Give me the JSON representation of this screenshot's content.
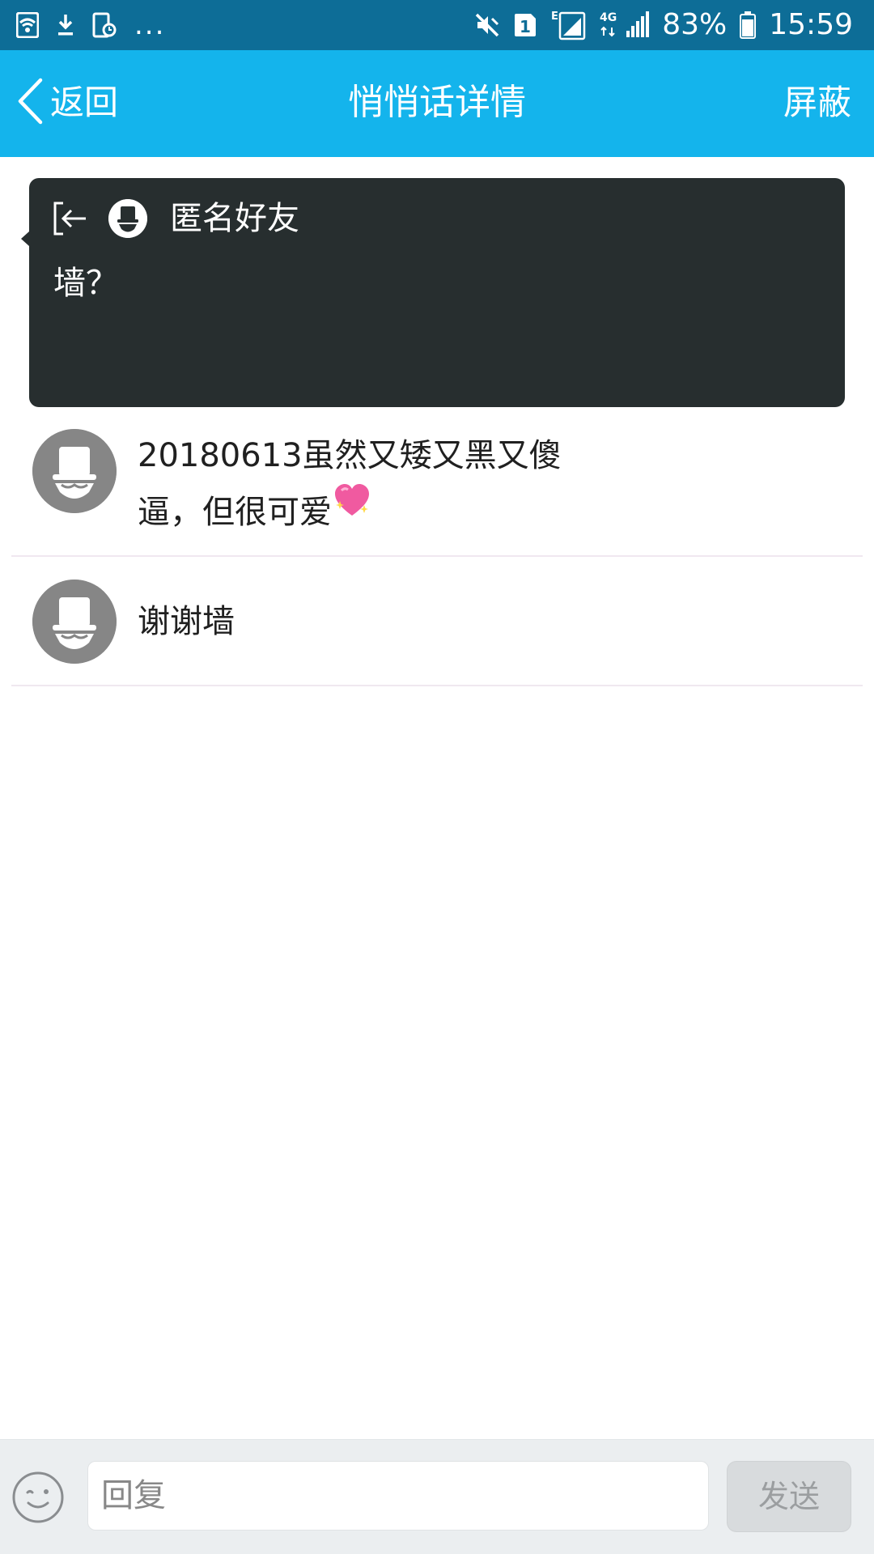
{
  "status_bar": {
    "overflow_indicator": "...",
    "sim_slot": "1",
    "network_e": "E",
    "network_4g": "4G",
    "battery_percent": "83%",
    "battery_level": 0.83,
    "time": "15:59",
    "icons": [
      "wifi-icon",
      "download-icon",
      "phone-clock-icon",
      "mute-icon",
      "sim-icon",
      "signal-icon",
      "battery-icon"
    ]
  },
  "title_bar": {
    "back_label": "返回",
    "title": "悄悄话详情",
    "action_label": "屏蔽",
    "background_color": "#14b4ec"
  },
  "message": {
    "sender": "匿名好友",
    "text": "墙？",
    "background_color": "#272e2f"
  },
  "replies": [
    {
      "text": "20180613虽然又矮又黑又傻逼，但很可爱",
      "emoji": "sparkling-heart-icon"
    },
    {
      "text": "谢谢墙"
    }
  ],
  "input_bar": {
    "placeholder": "回复",
    "value": "",
    "send_label": "发送"
  }
}
